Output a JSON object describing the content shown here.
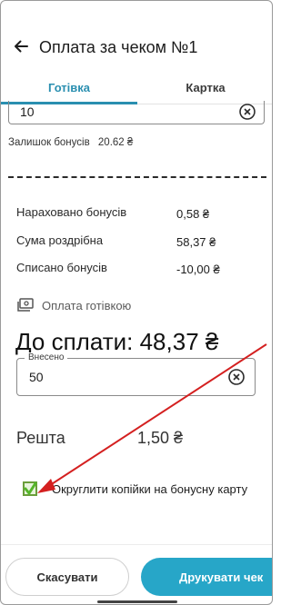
{
  "header": {
    "title": "Оплата за чеком №1",
    "back_icon": "arrow-left-icon"
  },
  "tabs": [
    {
      "label": "Готівка",
      "active": true
    },
    {
      "label": "Картка",
      "active": false
    }
  ],
  "bonus_input": {
    "value": "10"
  },
  "bonus_rest": {
    "label": "Залишок бонусів",
    "value": "20.62 ₴"
  },
  "summary": [
    {
      "label": "Нараховано бонусів",
      "value": "0,58 ₴"
    },
    {
      "label": "Сума роздрібна",
      "value": "58,37 ₴"
    },
    {
      "label": "Списано бонусів",
      "value": "-10,00 ₴"
    }
  ],
  "payment_mode": {
    "label": "Оплата готівкою",
    "icon": "cash-icon"
  },
  "to_pay": "До сплати: 48,37 ₴",
  "entered": {
    "label": "Внесено",
    "value": "50"
  },
  "change": {
    "label": "Решта",
    "value": "1,50 ₴"
  },
  "round_option": {
    "label": "Округлити копійки на бонусну карту",
    "checked": true
  },
  "buttons": {
    "cancel": "Скасувати",
    "print": "Друкувати чек"
  },
  "colors": {
    "accent": "#27a6c8",
    "annotation": "#d42020",
    "checkbox": "#6a9e3a"
  }
}
